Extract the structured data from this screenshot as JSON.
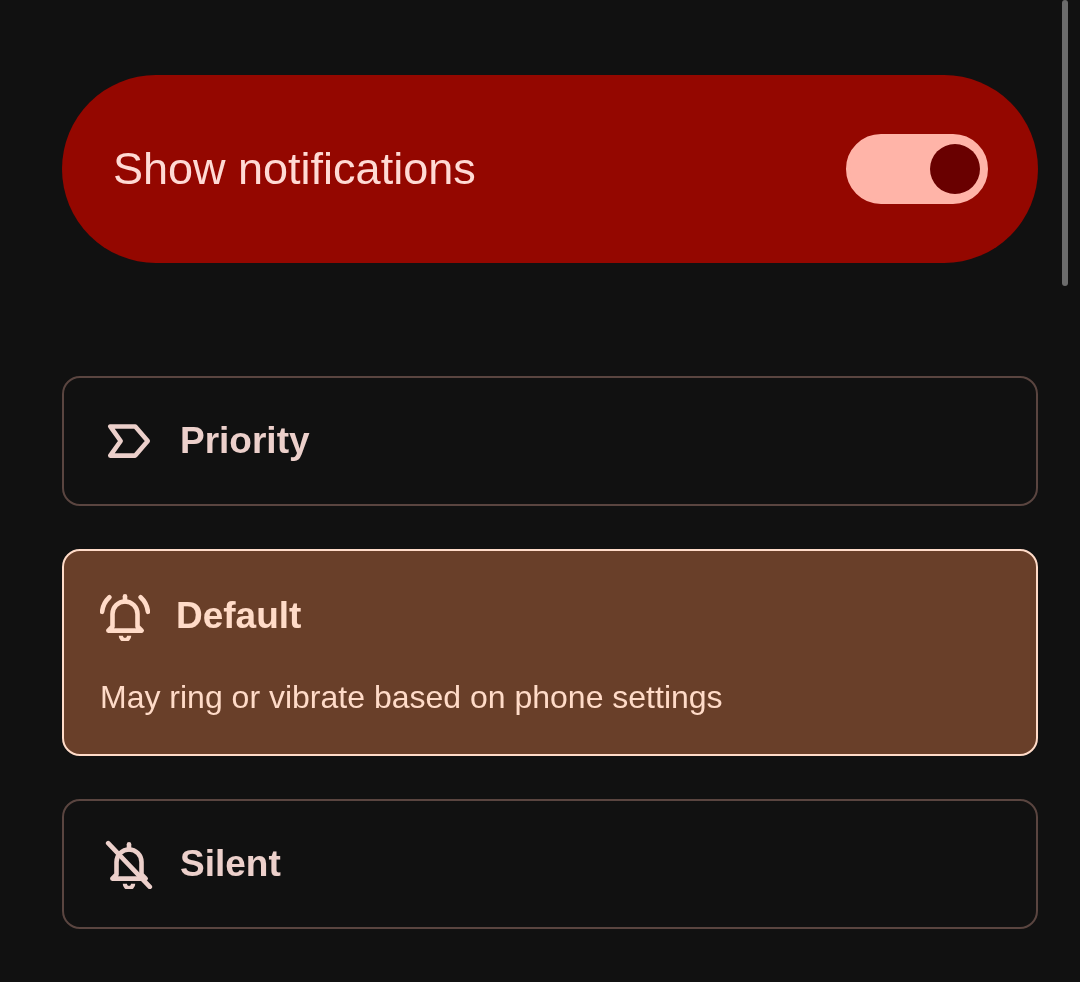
{
  "notifications_toggle": {
    "label": "Show notifications",
    "on": true
  },
  "options": [
    {
      "kind": "priority",
      "label": "Priority",
      "selected": false
    },
    {
      "kind": "default",
      "label": "Default",
      "selected": true,
      "description": "May ring or vibrate based on phone settings"
    },
    {
      "kind": "silent",
      "label": "Silent",
      "selected": false
    }
  ]
}
